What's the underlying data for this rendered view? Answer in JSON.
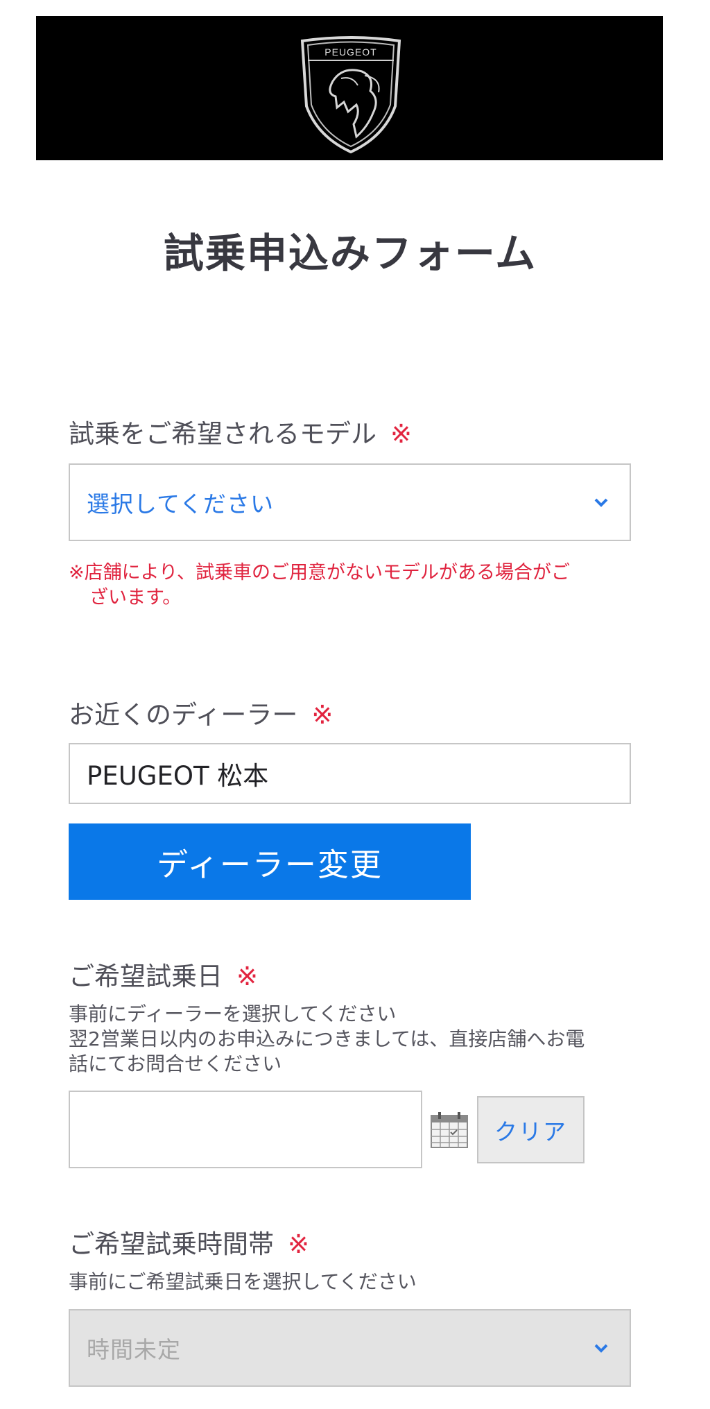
{
  "brand": {
    "name": "PEUGEOT"
  },
  "page": {
    "title": "試乗申込みフォーム"
  },
  "form": {
    "required_mark": "※",
    "model": {
      "label": "試乗をご希望されるモデル",
      "selected": "選択してください",
      "note_line1": "※店舗により、試乗車のご用意がないモデルがある場合がご",
      "note_line2": "ざいます。"
    },
    "dealer": {
      "label": "お近くのディーラー",
      "value": "PEUGEOT 松本",
      "change_button": "ディーラー変更"
    },
    "date": {
      "label": "ご希望試乗日",
      "help_line1": "事前にディーラーを選択してください",
      "help_line2": "翌2営業日以内のお申込みにつきましては、直接店舗へお電",
      "help_line3": "話にてお問合せください",
      "value": "",
      "clear_button": "クリア"
    },
    "time": {
      "label": "ご希望試乗時間帯",
      "help": "事前にご希望試乗日を選択してください",
      "selected": "時間未定"
    }
  },
  "icons": {
    "logo": "peugeot-lion-shield",
    "dropdown": "chevron-down-icon",
    "calendar": "calendar-icon"
  },
  "colors": {
    "header_bg": "#000000",
    "accent_blue": "#0a78e8",
    "required_red": "#e2243f",
    "disabled_bg": "#e3e3e3"
  }
}
